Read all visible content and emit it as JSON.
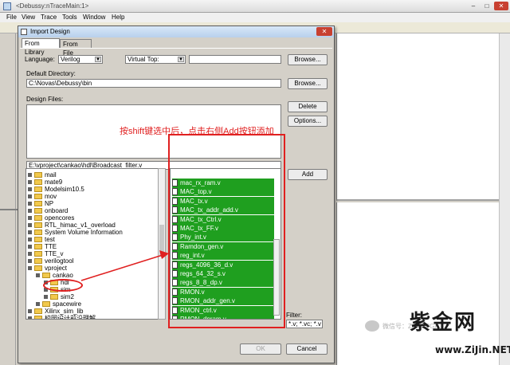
{
  "parent_window": {
    "title": "<Debussy:nTraceMain:1>",
    "menu": [
      "File",
      "View",
      "Trace",
      "Tools",
      "Window",
      "Help"
    ],
    "controls": {
      "minimize": "–",
      "maximize": "□",
      "close": "✕"
    }
  },
  "dialog": {
    "title": "Import Design",
    "close": "✕",
    "tabs": [
      "From Library",
      "From File"
    ],
    "active_tab": "From Library",
    "language_label": "Language:",
    "language_value": "Verilog",
    "virtual_top_value": "Virtual Top:",
    "virtual_top_field": "",
    "browse_label": "Browse...",
    "default_dir_label": "Default Directory:",
    "default_dir_value": "C:\\Novas\\Debussy\\bin",
    "design_files_label": "Design Files:",
    "delete_label": "Delete",
    "options_label": "Options...",
    "path_value": "E:\\vproject\\cankao\\hdl\\Broadcast_filter.v",
    "add_label": "Add",
    "filter_label": "Filter:",
    "filter_value": "*.v; *.vc; *.v",
    "ok_label": "OK",
    "cancel_label": "Cancel",
    "tree": [
      {
        "label": "mail",
        "expanded": false,
        "depth": 1
      },
      {
        "label": "mate9",
        "expanded": false,
        "depth": 1
      },
      {
        "label": "Modelsim10.5",
        "expanded": false,
        "depth": 1
      },
      {
        "label": "mov",
        "expanded": false,
        "depth": 1
      },
      {
        "label": "NP",
        "expanded": false,
        "depth": 1
      },
      {
        "label": "onboard",
        "expanded": false,
        "depth": 1
      },
      {
        "label": "opencores",
        "expanded": false,
        "depth": 1
      },
      {
        "label": "RTL_himac_v1_overload",
        "expanded": false,
        "depth": 1
      },
      {
        "label": "System Volume Information",
        "expanded": false,
        "depth": 1
      },
      {
        "label": "test",
        "expanded": false,
        "depth": 1
      },
      {
        "label": "TTE",
        "expanded": false,
        "depth": 1
      },
      {
        "label": "TTE_v",
        "expanded": false,
        "depth": 1
      },
      {
        "label": "verilogtool",
        "expanded": false,
        "depth": 1
      },
      {
        "label": "vproject",
        "expanded": true,
        "depth": 1
      },
      {
        "label": "cankao",
        "expanded": true,
        "depth": 2
      },
      {
        "label": "hdl",
        "expanded": false,
        "depth": 3
      },
      {
        "label": "sim",
        "expanded": false,
        "depth": 3
      },
      {
        "label": "sim2",
        "expanded": false,
        "depth": 3
      },
      {
        "label": "spacewire",
        "expanded": false,
        "depth": 2
      },
      {
        "label": "Xilinx_sim_lib",
        "expanded": false,
        "depth": 1
      },
      {
        "label": "校园设计前沿理解",
        "expanded": false,
        "depth": 1
      }
    ],
    "files": [
      "mac_rx_ram.v",
      "MAC_top.v",
      "MAC_tx.v",
      "MAC_tx_addr_add.v",
      "MAC_tx_Ctrl.v",
      "MAC_tx_FF.v",
      "Phy_int.v",
      "Ramdon_gen.v",
      "reg_int.v",
      "regs_4096_36_d.v",
      "regs_64_32_s.v",
      "regs_8_8_dp.v",
      "RMON.v",
      "RMON_addr_gen.v",
      "RMON_ctrl.v",
      "RMON_dpram.v"
    ]
  },
  "annotation": {
    "text": "按shift键选中后，点击右侧Add按钮添加",
    "color": "#e02020"
  },
  "watermark": {
    "title": "紫金网",
    "url": "www.ZiJin.NET",
    "wechat_text": "微信号：ZiJinFPGA"
  },
  "colors": {
    "selection_green": "#1f9f1f",
    "dialog_bg": "#d4d0c8",
    "annotation_red": "#e02020"
  }
}
